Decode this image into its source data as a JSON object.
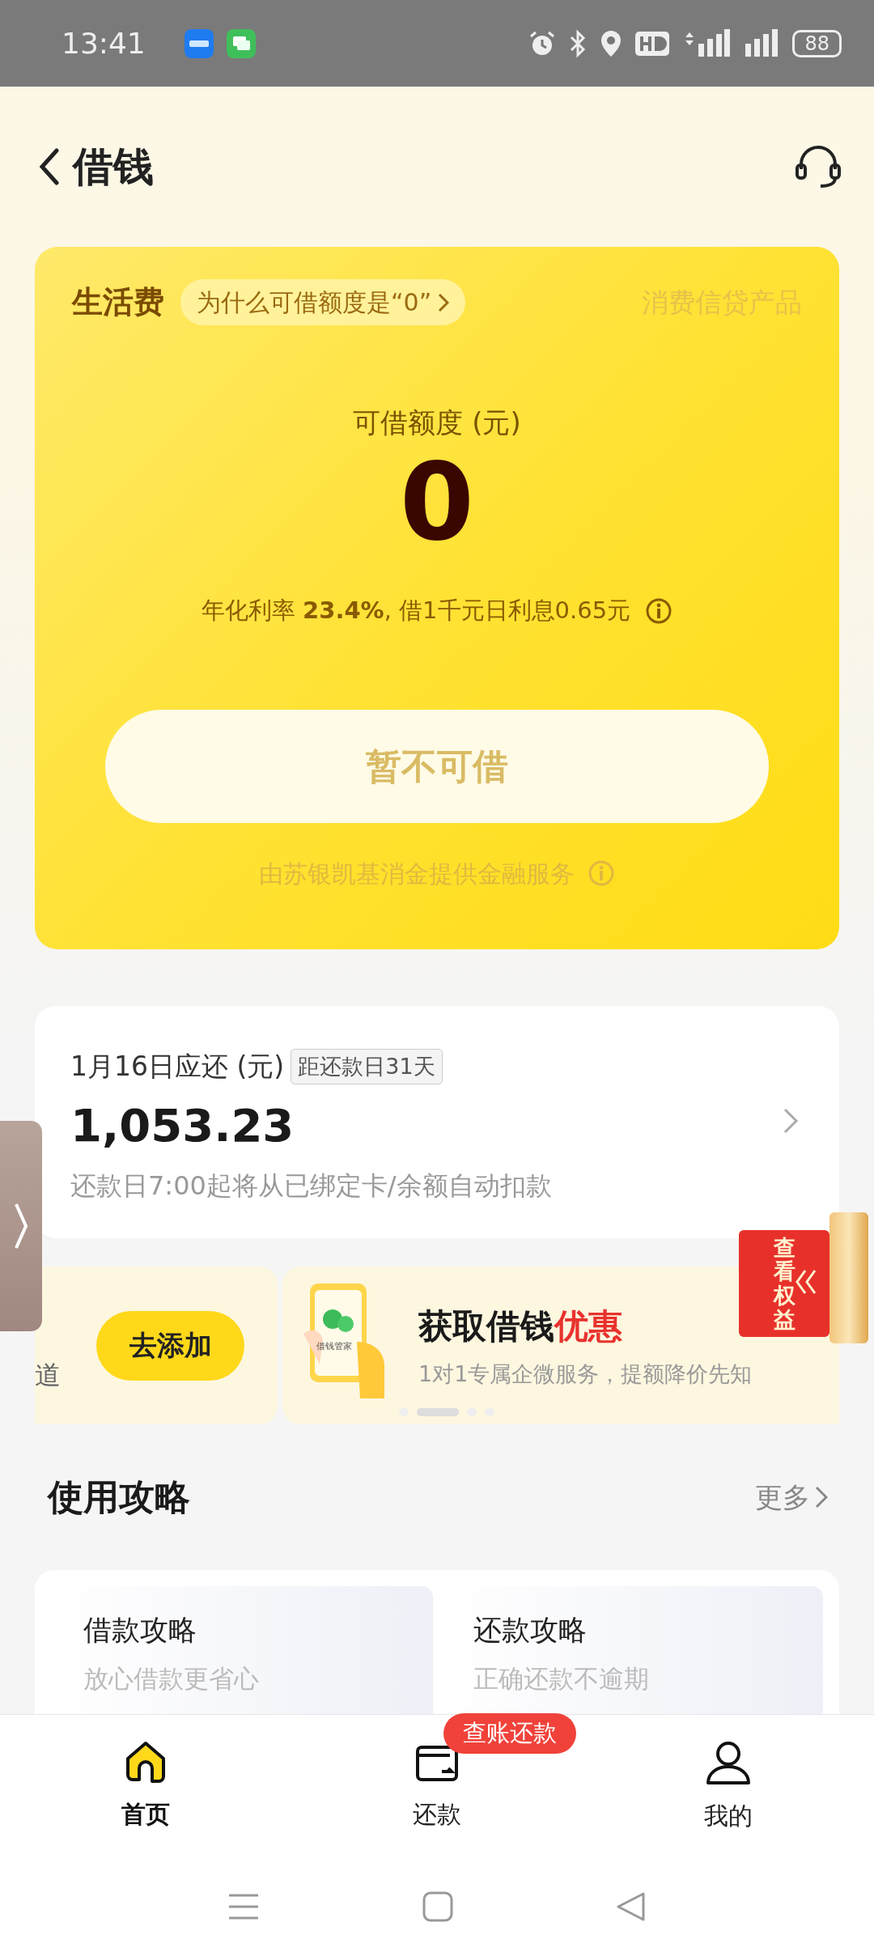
{
  "status_bar": {
    "time": "13:41",
    "battery": "88"
  },
  "header": {
    "title": "借钱"
  },
  "loan_card": {
    "product": "生活费",
    "why_link": "为什么可借额度是“0”",
    "category": "消费信贷产品",
    "amount_label": "可借额度 (元)",
    "amount": "0",
    "rate_text": "年化利率 **23.4%**, 借1千元日利息0.65元",
    "button": {
      "label": "暂不可借",
      "disabled": true
    },
    "provider": "由苏银凯基消金提供金融服务"
  },
  "repayment": {
    "title": "1月16日应还 (元)",
    "tag": "距还款日31天",
    "amount": "1,053.23",
    "note": "还款日7:00起将从已绑定卡/余额自动扣款"
  },
  "promo_ticket": {
    "label": "查看权益"
  },
  "banner": {
    "slides": [
      {
        "kind": "partial",
        "edge_text": "道",
        "button": "去添加"
      },
      {
        "kind": "promo",
        "phone_label": "借钱管家",
        "title": "获取借钱",
        "title_highlight": "优惠",
        "subtitle": "1对1专属企微服务，提额降价先知"
      }
    ],
    "dots": [
      {
        "selected": false
      },
      {
        "selected": true
      },
      {
        "selected": false
      },
      {
        "selected": false
      }
    ]
  },
  "guide": {
    "title": "使用攻略",
    "more": "更多",
    "cards": [
      {
        "title": "借款攻略",
        "subtitle": "放心借款更省心"
      },
      {
        "title": "还款攻略",
        "subtitle": "正确还款不逾期"
      }
    ]
  },
  "tab_bar": {
    "items": [
      {
        "label": "首页",
        "selected": true
      },
      {
        "label": "还款",
        "selected": false,
        "badge": "查账还款"
      },
      {
        "label": "我的",
        "selected": false
      }
    ]
  }
}
